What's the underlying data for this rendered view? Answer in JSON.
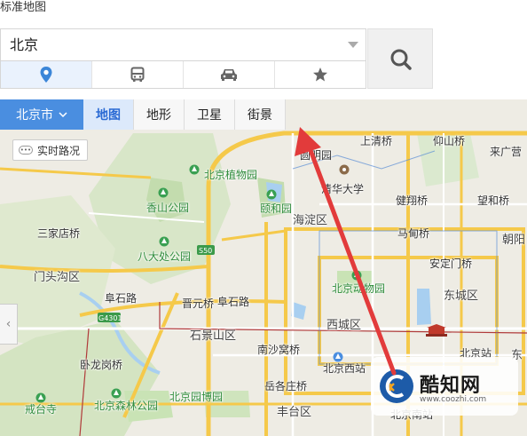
{
  "window": {
    "title": "标准地图"
  },
  "search": {
    "value": "北京"
  },
  "mode_tabs": [
    {
      "name": "location",
      "icon": "location-pin-icon",
      "active": true
    },
    {
      "name": "bus",
      "icon": "bus-icon",
      "active": false
    },
    {
      "name": "car",
      "icon": "car-icon",
      "active": false
    },
    {
      "name": "favorites",
      "icon": "star-icon",
      "active": false
    }
  ],
  "toolbar": {
    "city": "北京市",
    "types": [
      "地图",
      "地形",
      "卫星",
      "街景"
    ],
    "active_type": "地图"
  },
  "map": {
    "traffic_label": "实时路况",
    "traffic_icon_text": "•••",
    "labels": {
      "qinghe": "上清桥",
      "yangshan": "仰山桥",
      "laiguang": "来广营",
      "yuanmingyuan": "圆明园",
      "botanical": "北京植物园",
      "tsinghua": "清华大学",
      "jianxiang": "健翔桥",
      "wanghe": "望和桥",
      "xiangshan": "香山公园",
      "yiheyuan": "颐和园",
      "sanjiadian": "三家店桥",
      "badachu": "八大处公园",
      "haidian": "海淀区",
      "madian": "马甸桥",
      "chaoyang": "朝阳",
      "mentougou": "门头沟区",
      "anding": "安定门桥",
      "zoo": "北京动物园",
      "dongcheng": "东城区",
      "fushi": "阜石路",
      "jinyuan": "晋元桥",
      "fushi2": "阜石路",
      "g4301": "G4301",
      "s50": "S50",
      "shijingshan": "石景山区",
      "xicheng": "西城区",
      "nanshawo": "南沙窝桥",
      "wolong": "卧龙岗桥",
      "west_station": "北京西站",
      "beijing_station": "北京站",
      "dongbian": "东",
      "yuegezhuang": "岳各庄桥",
      "jieshou": "戒台寺",
      "forest": "北京森林公园",
      "garden_expo": "北京园博园",
      "fengtai": "丰台区",
      "south_station": "北京南站"
    }
  },
  "annotation": {
    "color": "#e23b3b"
  },
  "watermark": {
    "brand": "酷知网",
    "url": "www.coozhi.com"
  },
  "colors": {
    "accent": "#4a8ee0",
    "highway": "#f5c94a",
    "road": "#ffffff",
    "park": "#c9e3b5",
    "water": "#a8cff0"
  }
}
